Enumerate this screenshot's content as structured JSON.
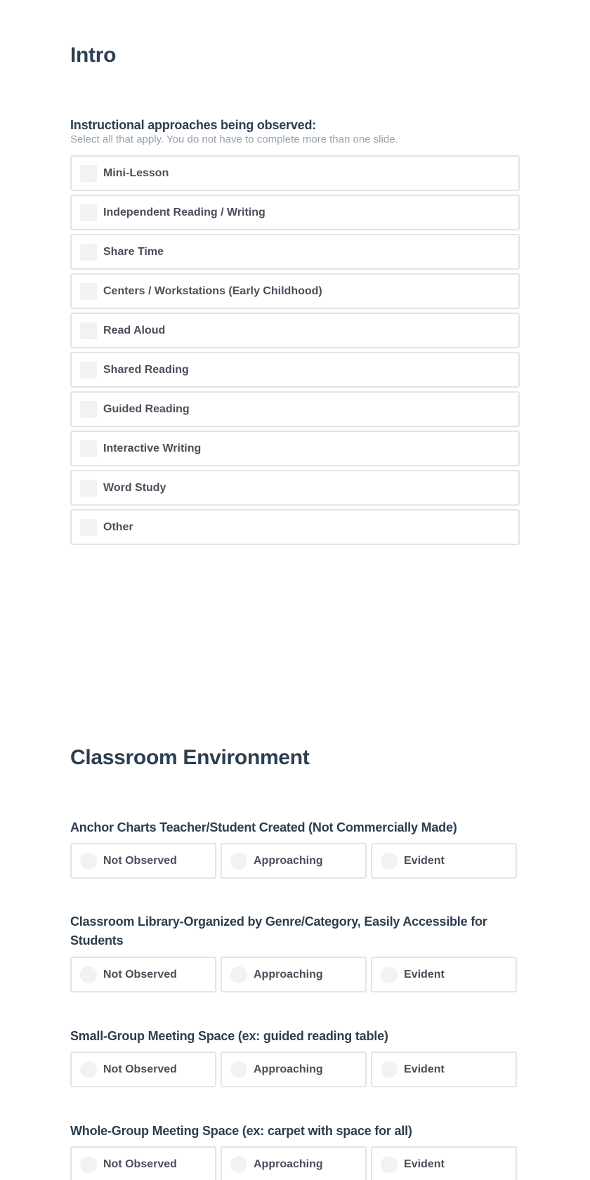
{
  "sections": {
    "intro": {
      "title": "Intro",
      "question": {
        "label": "Instructional approaches being observed:",
        "hint": "Select all that apply. You do not have to complete more than one slide.",
        "type": "checkbox",
        "options": [
          {
            "label": "Mini-Lesson",
            "checked": false
          },
          {
            "label": "Independent Reading / Writing",
            "checked": false
          },
          {
            "label": "Share Time",
            "checked": false
          },
          {
            "label": "Centers / Workstations (Early Childhood)",
            "checked": false
          },
          {
            "label": "Read Aloud",
            "checked": false
          },
          {
            "label": "Shared Reading",
            "checked": false
          },
          {
            "label": "Guided Reading",
            "checked": false
          },
          {
            "label": "Interactive Writing",
            "checked": false
          },
          {
            "label": "Word Study",
            "checked": false
          },
          {
            "label": "Other",
            "checked": false
          }
        ]
      }
    },
    "environment": {
      "title": "Classroom Environment",
      "questions": [
        {
          "label": "Anchor Charts Teacher/Student Created (Not Commercially Made)",
          "options": [
            "Not Observed",
            "Approaching",
            "Evident"
          ],
          "selected": null
        },
        {
          "label": "Classroom Library-Organized by Genre/Category, Easily Accessible for Students",
          "options": [
            "Not Observed",
            "Approaching",
            "Evident"
          ],
          "selected": null
        },
        {
          "label": "Small-Group Meeting Space (ex: guided reading table)",
          "options": [
            "Not Observed",
            "Approaching",
            "Evident"
          ],
          "selected": null
        },
        {
          "label": "Whole-Group Meeting Space (ex: carpet with space for all)",
          "options": [
            "Not Observed",
            "Approaching",
            "Evident"
          ],
          "selected": null
        }
      ]
    }
  },
  "colors": {
    "heading": "#2c3e50",
    "option_text": "#4a4f5a",
    "hint_text": "#9aa0a6",
    "border": "#e4e4e4",
    "control_fill": "#f2f2f2"
  }
}
